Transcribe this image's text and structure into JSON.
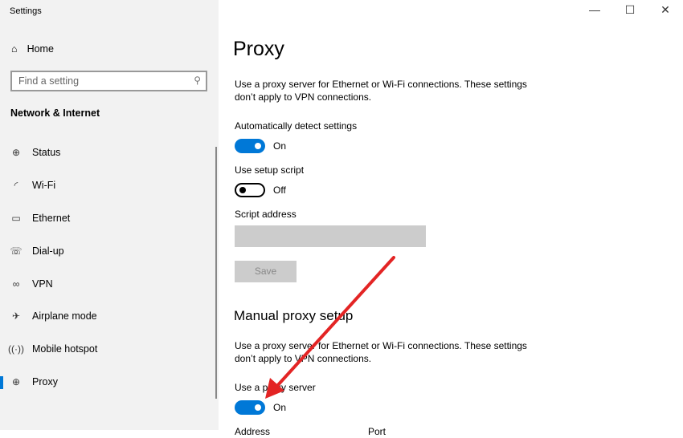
{
  "window": {
    "title": "Settings",
    "controls": [
      "—",
      "☐",
      "✕"
    ]
  },
  "sidebar": {
    "home": "Home",
    "search_placeholder": "Find a setting",
    "section": "Network & Internet",
    "items": [
      {
        "label": "Status",
        "icon": "globe-monitor-icon",
        "glyph": "⊕"
      },
      {
        "label": "Wi-Fi",
        "icon": "wifi-icon",
        "glyph": "◜"
      },
      {
        "label": "Ethernet",
        "icon": "ethernet-icon",
        "glyph": "▭"
      },
      {
        "label": "Dial-up",
        "icon": "dialup-icon",
        "glyph": "☏"
      },
      {
        "label": "VPN",
        "icon": "vpn-icon",
        "glyph": "∞"
      },
      {
        "label": "Airplane mode",
        "icon": "airplane-icon",
        "glyph": "✈"
      },
      {
        "label": "Mobile hotspot",
        "icon": "hotspot-icon",
        "glyph": "((·))"
      },
      {
        "label": "Proxy",
        "icon": "globe-icon",
        "glyph": "⊕"
      }
    ],
    "active": "Proxy"
  },
  "main": {
    "title": "Proxy",
    "auto_desc1": "Use a proxy server for Ethernet or Wi-Fi connections. These settings",
    "auto_desc2": "don’t apply to VPN connections.",
    "auto_detect_label": "Automatically detect settings",
    "auto_detect_state": "On",
    "setup_script_label": "Use setup script",
    "setup_script_state": "Off",
    "script_address_label": "Script address",
    "save": "Save",
    "manual_title": "Manual proxy setup",
    "manual_desc1": "Use a proxy server for Ethernet or Wi-Fi connections. These settings",
    "manual_desc2": "don’t apply to VPN connections.",
    "use_proxy_label": "Use a proxy server",
    "use_proxy_state": "On",
    "address_label": "Address",
    "port_label": "Port"
  },
  "annotation": {
    "arrow_color": "#e32424"
  }
}
